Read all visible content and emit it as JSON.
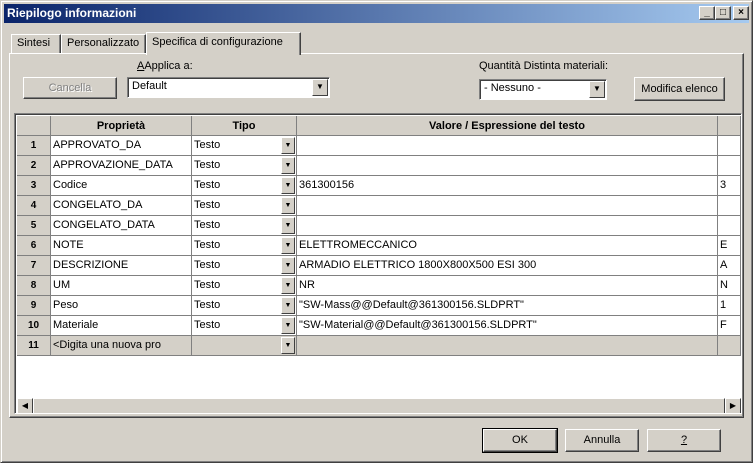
{
  "window": {
    "title": "Riepilogo informazioni",
    "controls": {
      "minimize": "_",
      "maximize": "□",
      "close": "×"
    }
  },
  "tabs": [
    "Sintesi",
    "Personalizzato",
    "Specifica di configurazione"
  ],
  "active_tab": "Specifica di configurazione",
  "toolbar": {
    "cancel_label": "Cancella",
    "apply_to_label": "Applica a:",
    "apply_to_value": "Default",
    "bom_qty_label": "Quantità Distinta materiali:",
    "bom_qty_value": "- Nessuno -",
    "edit_list_label": "Modifica elenco"
  },
  "table": {
    "headers": [
      "Proprietà",
      "Tipo",
      "Valore / Espressione del testo"
    ],
    "rows": [
      {
        "num": "1",
        "prop": "APPROVATO_DA",
        "type": "Testo",
        "value": "",
        "extra": ""
      },
      {
        "num": "2",
        "prop": "APPROVAZIONE_DATA",
        "type": "Testo",
        "value": "",
        "extra": ""
      },
      {
        "num": "3",
        "prop": "Codice",
        "type": "Testo",
        "value": "361300156",
        "extra": "3"
      },
      {
        "num": "4",
        "prop": "CONGELATO_DA",
        "type": "Testo",
        "value": "",
        "extra": ""
      },
      {
        "num": "5",
        "prop": "CONGELATO_DATA",
        "type": "Testo",
        "value": "",
        "extra": ""
      },
      {
        "num": "6",
        "prop": "NOTE",
        "type": "Testo",
        "value": "ELETTROMECCANICO",
        "extra": "E"
      },
      {
        "num": "7",
        "prop": "DESCRIZIONE",
        "type": "Testo",
        "value": "ARMADIO ELETTRICO 1800X800X500 ESI 300",
        "extra": "A"
      },
      {
        "num": "8",
        "prop": "UM",
        "type": "Testo",
        "value": "NR",
        "extra": "N"
      },
      {
        "num": "9",
        "prop": "Peso",
        "type": "Testo",
        "value": "\"SW-Mass@@Default@361300156.SLDPRT\"",
        "extra": "1"
      },
      {
        "num": "10",
        "prop": "Materiale",
        "type": "Testo",
        "value": "\"SW-Material@@Default@361300156.SLDPRT\"",
        "extra": "F"
      }
    ],
    "new_row": {
      "num": "11",
      "placeholder": "<Digita una nuova pro"
    }
  },
  "footer": {
    "ok_label": "OK",
    "cancel_label": "Annulla",
    "help_label": "?"
  }
}
